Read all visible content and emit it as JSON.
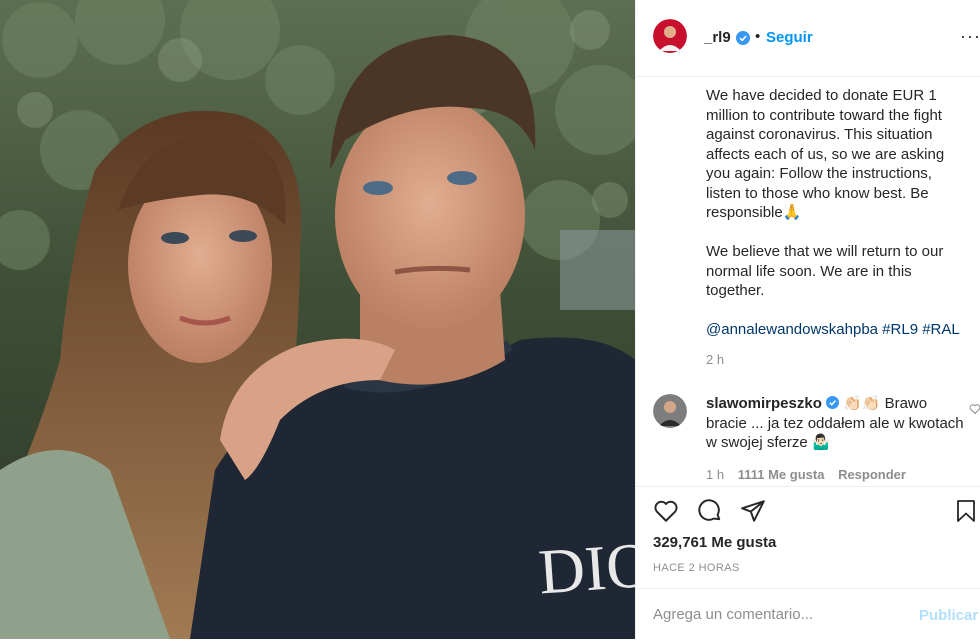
{
  "post": {
    "username": "_rl9",
    "follow_label": "Seguir",
    "more_label": "···",
    "caption_p1": "We have decided to donate EUR 1 million to contribute toward the fight against coronavirus. This situation affects each of us, so we are asking you again: Follow the instructions, listen to those who know best. Be responsible🙏",
    "caption_p2": "We believe that we will return to our normal life soon. We are in this together.",
    "caption_tags": "@annalewandowskahpba #RL9 #RAL",
    "caption_time": "2 h"
  },
  "comment": {
    "username": "slawomirpeszko",
    "text": " 👏🏻👏🏻 Brawo bracie ... ja tez oddałem ale w kwotach w swojej sferze 🤷🏻‍♂️",
    "time": "1 h",
    "likes": "1111 Me gusta",
    "reply_label": "Responder"
  },
  "footer": {
    "likes": "329,761 Me gusta",
    "ago": "HACE 2 HORAS",
    "comment_placeholder": "Agrega un comentario...",
    "publish_label": "Publicar"
  },
  "colors": {
    "accent": "#0095f6",
    "link": "#00376b",
    "muted": "#8e8e8e",
    "publish_disabled": "#b2dffc"
  }
}
